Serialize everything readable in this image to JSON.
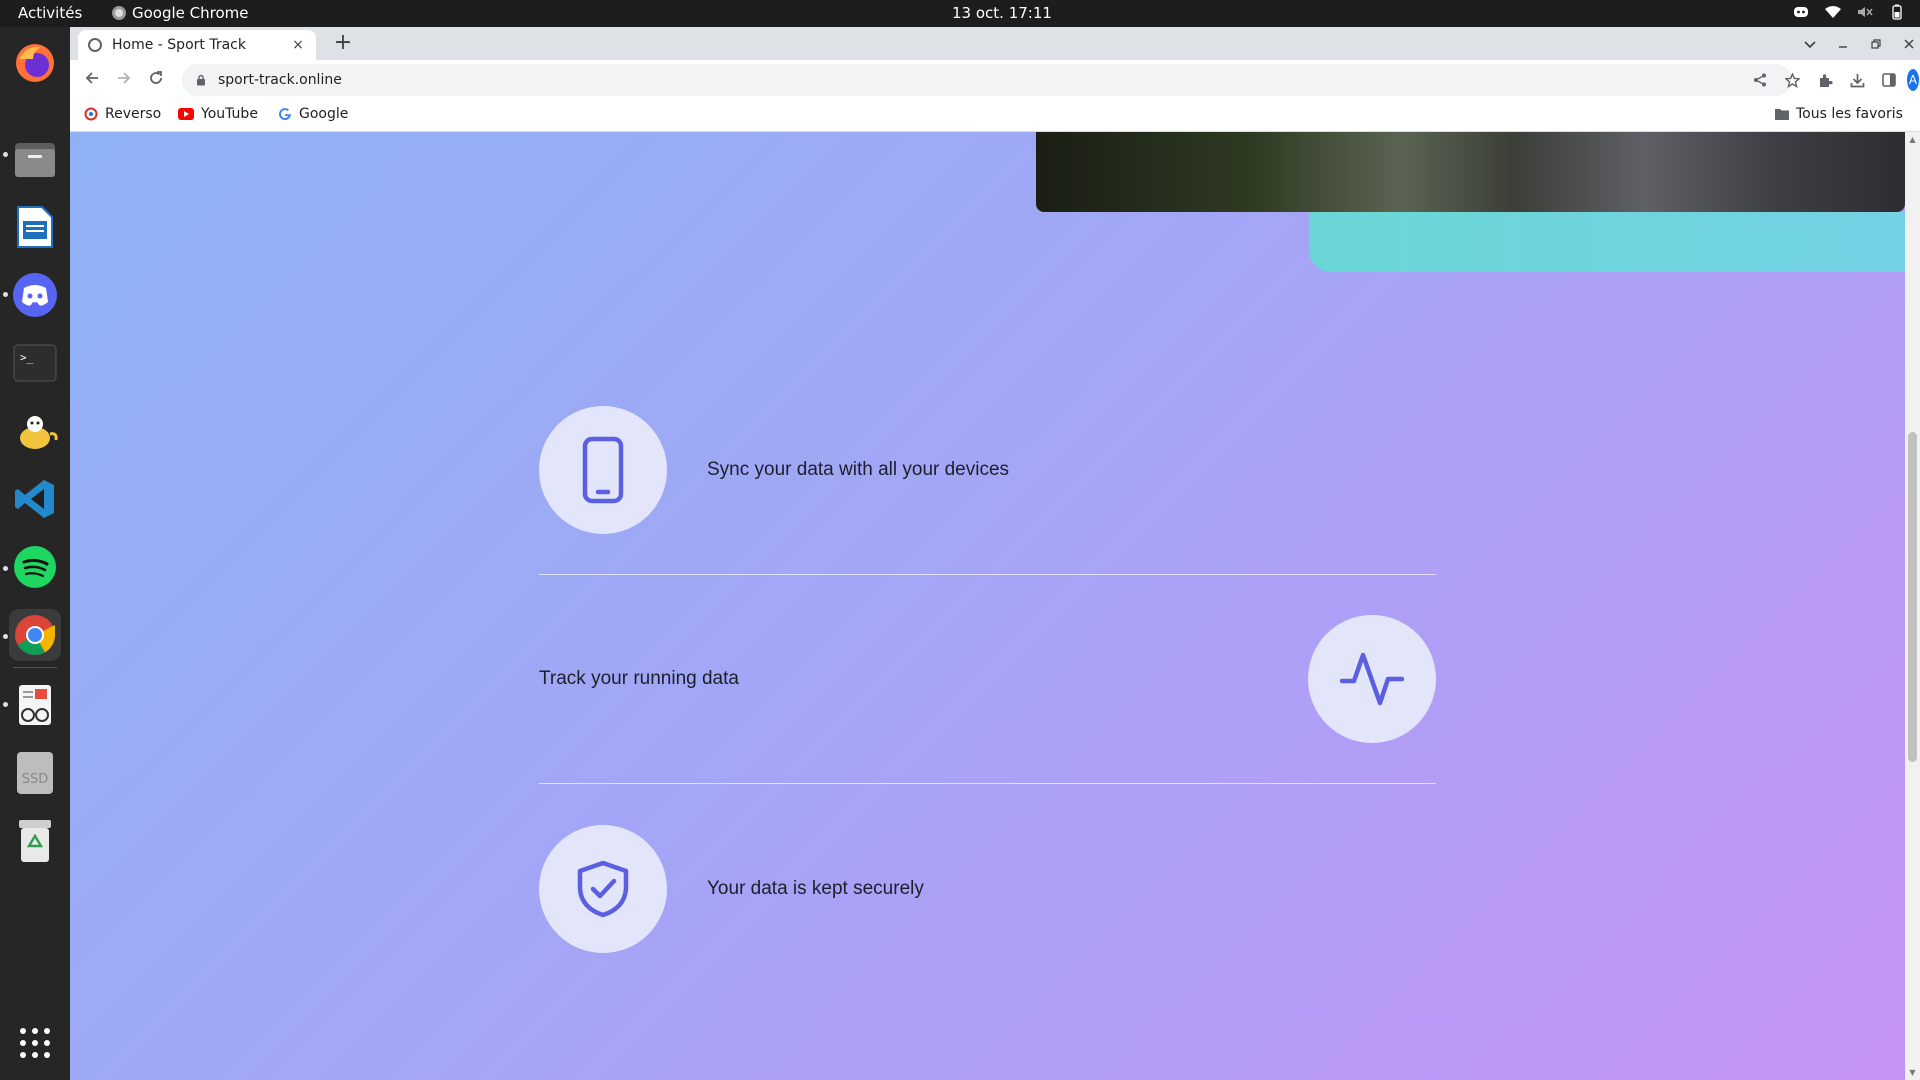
{
  "system_bar": {
    "activities": "Activités",
    "app_name": "Google Chrome",
    "clock": "13 oct.  17:11"
  },
  "dock": {
    "items": [
      "firefox-icon",
      "files-icon",
      "writer-icon",
      "discord-icon",
      "terminal-icon",
      "teapot-icon",
      "vscode-icon",
      "spotify-icon",
      "chrome-icon",
      "reader-icon",
      "ssd-icon",
      "trash-icon",
      "apps-grid-icon"
    ],
    "ssd_label": "SSD"
  },
  "browser": {
    "tab_title": "Home - Sport Track",
    "tab_close": "×",
    "new_tab": "+",
    "url": "sport-track.online",
    "avatar_letter": "A",
    "bookmarks": [
      {
        "label": "Reverso"
      },
      {
        "label": "YouTube"
      },
      {
        "label": "Google"
      }
    ],
    "all_bookmarks": "Tous les favoris"
  },
  "features": [
    {
      "text": "Sync your data with all your devices",
      "icon": "phone-icon"
    },
    {
      "text": "Track your running data",
      "icon": "activity-pulse-icon"
    },
    {
      "text": "Your data is kept securely",
      "icon": "shield-check-icon"
    }
  ],
  "colors": {
    "gradient_start": "#8fb2f6",
    "gradient_end": "#c493f5",
    "icon_accent": "#5b5fe0",
    "teal": "#6ad6d6"
  }
}
